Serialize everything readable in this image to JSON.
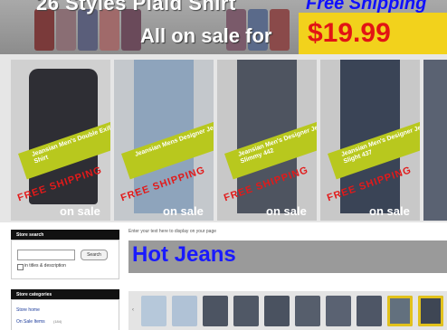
{
  "banner": {
    "title": "26 Styles Plaid Shirt",
    "free_shipping": "Free Shipping",
    "sale_text": "All on sale for",
    "price": "$19.99"
  },
  "products": [
    {
      "ribbon": "Jeansian Men's Double Exif Long Shirt",
      "free": "FREE SHIPPING",
      "sale": "on sale",
      "color": "#3a3a40"
    },
    {
      "ribbon": "Jeansian Mens Designer Jeans Zip43",
      "free": "FREE SHIPPING",
      "sale": "on sale",
      "color": "#8aa0b8"
    },
    {
      "ribbon": "Jeansian Men's Designer Jeans Slimmy 442",
      "free": "FREE SHIPPING",
      "sale": "on sale",
      "color": "#4f5560"
    },
    {
      "ribbon": "Jeansian Men's Designer Jeans Slight 437",
      "free": "FREE SHIPPING",
      "sale": "on sale",
      "color": "#3c4658"
    }
  ],
  "sidebar": {
    "search_title": "Store search",
    "search_button": "Search",
    "search_option": "in titles & description",
    "categories_title": "Store categories",
    "store_home": "Store home",
    "on_sale_items": "On Sale Items",
    "on_sale_count": "(184)"
  },
  "main": {
    "hint": "Enter your text here to display on your page",
    "page_title": "Hot Jeans"
  },
  "thumbnails": [
    "#b6c8da",
    "#b0c2d6",
    "#4c5462",
    "#505866",
    "#4a5260",
    "#565e6c",
    "#5a6272",
    "#4e5666",
    "#62707e",
    "#3e4654"
  ],
  "colors": {
    "title_blue": "#1a1aff",
    "price_red": "#e21414",
    "ribbon_green": "#b8c81e",
    "burst_yellow": "#f2d21c"
  }
}
